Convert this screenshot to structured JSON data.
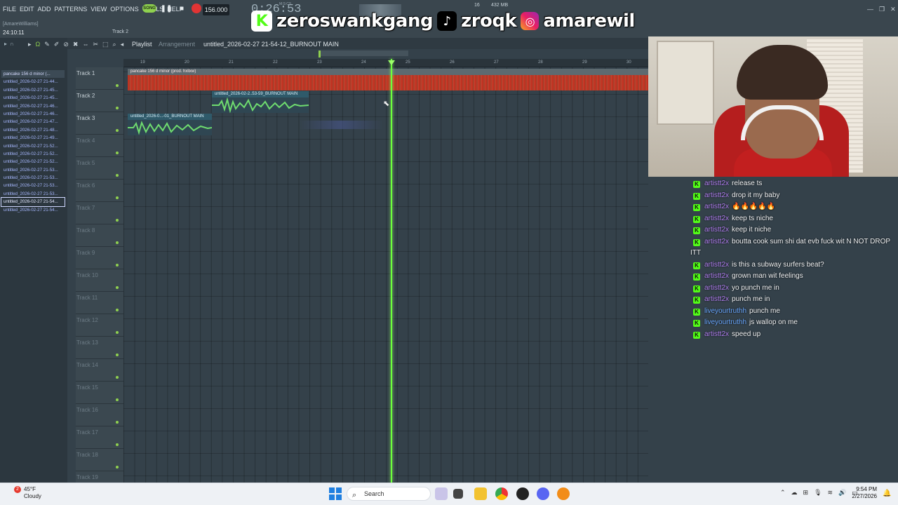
{
  "menu": [
    "FILE",
    "EDIT",
    "ADD",
    "PATTERNS",
    "VIEW",
    "OPTIONS",
    "TOOLS",
    "HELP"
  ],
  "hint": "[AmareWilliams]",
  "timer": "24:10:11",
  "track_label": "Track 2",
  "transport": {
    "song_label": "SONG",
    "tempo": "156.000",
    "clock": "0:26:53",
    "clock_units": "M:S:CS",
    "cpu": "16",
    "mem": "432 MB"
  },
  "overlay": {
    "kick": "zeroswankgang",
    "tiktok": "zroqk",
    "instagram": "amarewil"
  },
  "browser": {
    "items": [
      "pancake 156 d minor (...",
      "untitled_2026-02-27 21-44...",
      "untitled_2026-02-27 21-45...",
      "untitled_2026-02-27 21-45...",
      "untitled_2026-02-27 21-46...",
      "untitled_2026-02-27 21-46...",
      "untitled_2026-02-27 21-47...",
      "untitled_2026-02-27 21-48...",
      "untitled_2026-02-27 21-49...",
      "untitled_2026-02-27 21-52...",
      "untitled_2026-02-27 21-52...",
      "untitled_2026-02-27 21-52...",
      "untitled_2026-02-27 21-53...",
      "untitled_2026-02-27 21-53...",
      "untitled_2026-02-27 21-53...",
      "untitled_2026-02-27 21-53...",
      "untitled_2026-02-27 21-54...",
      "untitled_2026-02-27 21-54..."
    ],
    "selected_index": 16
  },
  "playlist": {
    "title": "Playlist",
    "subtitle": "Arrangement",
    "name": "untitled_2026-02-27 21-54-12_BURNOUT MAIN",
    "ruler": [
      "19",
      "20",
      "21",
      "22",
      "23",
      "24",
      "25",
      "26",
      "27",
      "28",
      "29",
      "30"
    ],
    "tracks": [
      "Track 1",
      "Track 2",
      "Track 3",
      "Track 4",
      "Track 5",
      "Track 6",
      "Track 7",
      "Track 8",
      "Track 9",
      "Track 10",
      "Track 11",
      "Track 12",
      "Track 13",
      "Track 14",
      "Track 15",
      "Track 16",
      "Track 17",
      "Track 18",
      "Track 19"
    ],
    "clips": {
      "clip1": "pancake 156 d minor (prod. hxlixw)",
      "clip2": "untitled_2026-02-2..53-59_BURNOUT MAIN",
      "clip3": "untitled_2026-0...-01_BURNOUT MAIN"
    }
  },
  "chat": [
    {
      "user": "artistt2x",
      "msg": "release ts",
      "alt": false
    },
    {
      "user": "artistt2x",
      "msg": "drop it my baby",
      "alt": false
    },
    {
      "user": "artistt2x",
      "msg": "🔥🔥🔥🔥🔥",
      "alt": false
    },
    {
      "user": "artistt2x",
      "msg": "keep ts niche",
      "alt": false
    },
    {
      "user": "artistt2x",
      "msg": "keep it niche",
      "alt": false
    },
    {
      "user": "artistt2x",
      "msg": "boutta cook sum shi dat evb fuck wit N NOT DROP ITT",
      "alt": false
    },
    {
      "user": "artistt2x",
      "msg": "is this a subway surfers beat?",
      "alt": false
    },
    {
      "user": "artistt2x",
      "msg": "grown man wit feelings",
      "alt": false
    },
    {
      "user": "artistt2x",
      "msg": "yo punch me in",
      "alt": false
    },
    {
      "user": "artistt2x",
      "msg": "punch me in",
      "alt": false
    },
    {
      "user": "liveyourtruthh",
      "msg": "punch me",
      "alt": true
    },
    {
      "user": "liveyourtruthh",
      "msg": "js wallop on me",
      "alt": true
    },
    {
      "user": "artistt2x",
      "msg": "speed up",
      "alt": false
    }
  ],
  "taskbar": {
    "weather_temp": "45°F",
    "weather_desc": "Cloudy",
    "weather_badge": "2",
    "search_placeholder": "Search",
    "time": "9:54 PM",
    "date": "2/27/2026"
  },
  "colors": {
    "accent": "#8fd14f",
    "playhead": "#6cff3c",
    "kick": "#53fc18",
    "clip_red": "#c6311f"
  }
}
